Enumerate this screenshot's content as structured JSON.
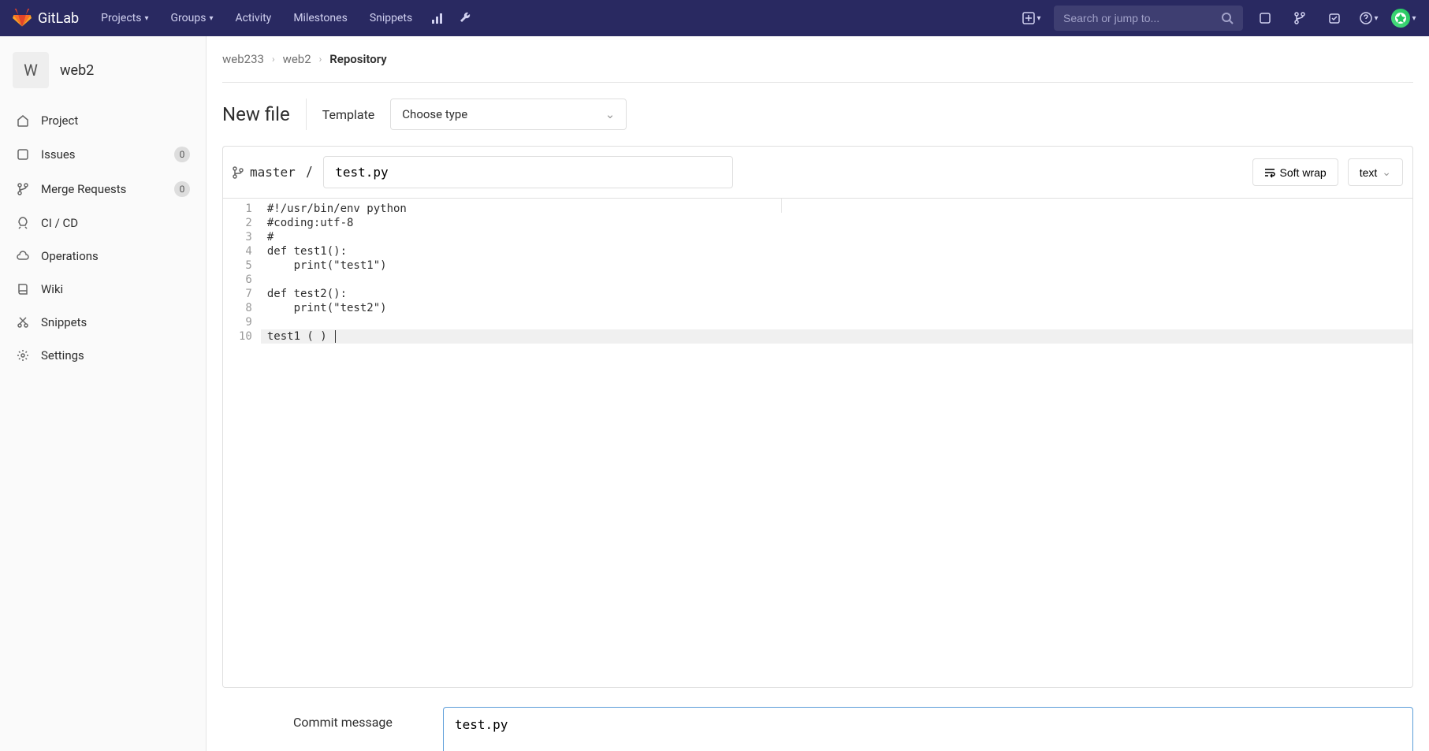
{
  "navbar": {
    "brand": "GitLab",
    "items": [
      "Projects",
      "Groups",
      "Activity",
      "Milestones",
      "Snippets"
    ],
    "search_placeholder": "Search or jump to..."
  },
  "sidebar": {
    "project_initial": "W",
    "project_name": "web2",
    "items": [
      {
        "label": "Project",
        "icon": "home"
      },
      {
        "label": "Issues",
        "icon": "issues",
        "badge": "0"
      },
      {
        "label": "Merge Requests",
        "icon": "merge",
        "badge": "0"
      },
      {
        "label": "CI / CD",
        "icon": "rocket"
      },
      {
        "label": "Operations",
        "icon": "cloud"
      },
      {
        "label": "Wiki",
        "icon": "book"
      },
      {
        "label": "Snippets",
        "icon": "snippets"
      },
      {
        "label": "Settings",
        "icon": "gear"
      }
    ]
  },
  "breadcrumb": [
    "web233",
    "web2",
    "Repository"
  ],
  "page": {
    "title": "New file",
    "template_label": "Template",
    "template_placeholder": "Choose type"
  },
  "editor": {
    "branch": "master",
    "filename": "test.py",
    "soft_wrap_label": "Soft wrap",
    "syntax_label": "text",
    "lines": [
      "#!/usr/bin/env python",
      "#coding:utf-8",
      "#",
      "def test1():",
      "    print(\"test1\")",
      "",
      "def test2():",
      "    print(\"test2\")",
      "",
      "test1 ( ) "
    ],
    "current_line": 10
  },
  "commit": {
    "label": "Commit message",
    "message": "test.py"
  }
}
